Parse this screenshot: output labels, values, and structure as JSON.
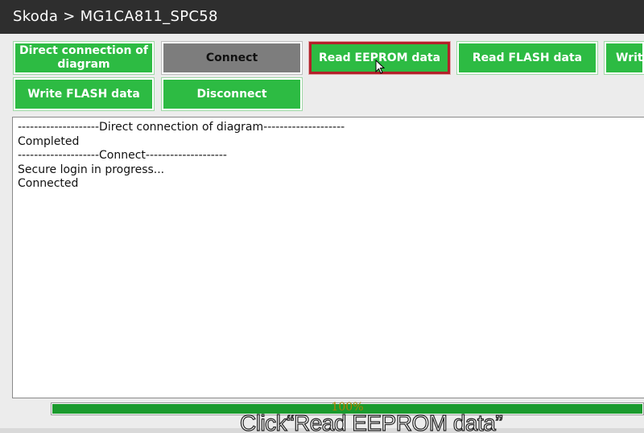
{
  "window": {
    "title": "Skoda > MG1CA811_SPC58"
  },
  "toolbar": {
    "row1": [
      "Direct connection of diagram",
      "Connect",
      "Read EEPROM data",
      "Read FLASH data",
      "Write"
    ],
    "row2": [
      "Write FLASH data",
      "Disconnect"
    ],
    "selected": "Read EEPROM data"
  },
  "log": {
    "lines": [
      "--------------------Direct connection of diagram--------------------",
      "Completed",
      "--------------------Connect--------------------",
      "Secure login in progress...",
      "Connected"
    ]
  },
  "progress": {
    "value": 100,
    "label": "100%"
  },
  "caption": {
    "text": "Click“Read EEPROM data”"
  },
  "colors": {
    "button_green": "#2dbb43",
    "button_gray": "#7d7d7d",
    "selected_border": "#b3202a",
    "progress_fill": "#1b9a2e",
    "title_bar": "#2e2e2e"
  },
  "icons": {
    "cursor": "mouse-pointer-icon"
  }
}
